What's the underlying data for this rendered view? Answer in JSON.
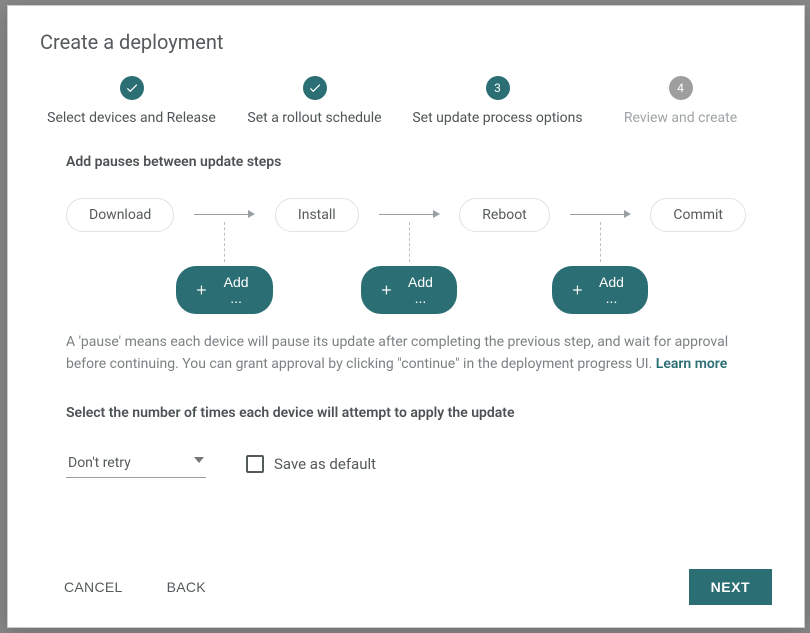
{
  "title": "Create a deployment",
  "stepper": {
    "steps": [
      {
        "label": "Select devices and Release",
        "state": "done"
      },
      {
        "label": "Set a rollout schedule",
        "state": "done"
      },
      {
        "label": "Set update process options",
        "state": "current",
        "num": "3"
      },
      {
        "label": "Review and create",
        "state": "future",
        "num": "4"
      }
    ]
  },
  "pauses": {
    "heading": "Add pauses between update steps",
    "nodes": [
      "Download",
      "Install",
      "Reboot",
      "Commit"
    ],
    "add_label": "Add ...",
    "description_before": "A 'pause' means each device will pause its update after completing the previous step, and wait for approval before continuing. You can grant approval by clicking \"continue\" in the deployment progress UI. ",
    "learn_more": "Learn more"
  },
  "retry": {
    "heading": "Select the number of times each device will attempt to apply the update",
    "select_value": "Don't retry",
    "save_default_label": "Save as default"
  },
  "footer": {
    "cancel": "CANCEL",
    "back": "BACK",
    "next": "NEXT"
  },
  "colors": {
    "accent": "#2b6e73"
  }
}
